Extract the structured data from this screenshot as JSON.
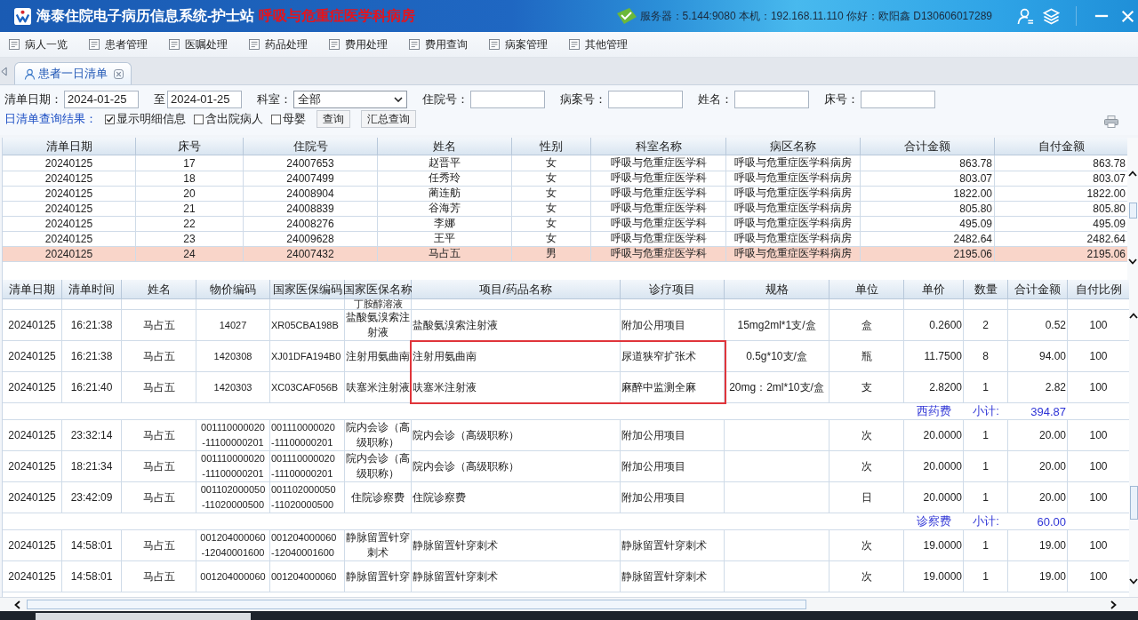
{
  "title_bar": {
    "title": "海泰住院电子病历信息系统-护士站",
    "ward": "呼吸与危重症医学科病房",
    "server_info": "服务器：5.144:9080 本机：192.168.11.110 你好：欧阳鑫 D130606017289"
  },
  "menu": [
    {
      "label": "病人一览"
    },
    {
      "label": "患者管理"
    },
    {
      "label": "医嘱处理"
    },
    {
      "label": "药品处理"
    },
    {
      "label": "费用处理"
    },
    {
      "label": "费用查询"
    },
    {
      "label": "病案管理"
    },
    {
      "label": "其他管理"
    }
  ],
  "tabs": [
    {
      "label": "患者一日清单",
      "selected": true
    }
  ],
  "filters": [
    {
      "label": "清单日期：",
      "kind": "date",
      "value": "2024-01-25"
    },
    {
      "label": "至",
      "kind": "date",
      "value": "2024-01-25"
    },
    {
      "label": "科室：",
      "kind": "select",
      "value": "全部"
    },
    {
      "label": "住院号：",
      "kind": "text"
    },
    {
      "label": "病案号：",
      "kind": "text"
    },
    {
      "label": "姓名：",
      "kind": "text"
    },
    {
      "label": "床号：",
      "kind": "text"
    }
  ],
  "result_bar": {
    "label": "日清单查询结果：",
    "options": [
      {
        "label": "显示明细信息",
        "checked": true
      },
      {
        "label": "含出院病人",
        "checked": false
      },
      {
        "label": "母婴",
        "checked": false
      }
    ],
    "buttons": [
      {
        "label": "查询"
      },
      {
        "label": "汇总查询"
      }
    ]
  },
  "summary_table": {
    "columns": [
      {
        "label": "清单日期"
      },
      {
        "label": "床号"
      },
      {
        "label": "住院号"
      },
      {
        "label": "姓名"
      },
      {
        "label": "性别"
      },
      {
        "label": "科室名称"
      },
      {
        "label": "病区名称"
      },
      {
        "label": "合计金额"
      },
      {
        "label": "自付金额"
      }
    ],
    "rows": [
      {
        "cells": [
          "20240125",
          "17",
          "24007653",
          "赵晋平",
          "女",
          "呼吸与危重症医学科",
          "呼吸与危重症医学科病房",
          "863.78",
          "863.78"
        ],
        "selected": false
      },
      {
        "cells": [
          "20240125",
          "18",
          "24007499",
          "任秀玲",
          "女",
          "呼吸与危重症医学科",
          "呼吸与危重症医学科病房",
          "803.07",
          "803.07"
        ],
        "selected": false
      },
      {
        "cells": [
          "20240125",
          "20",
          "24008904",
          "蔺连舫",
          "女",
          "呼吸与危重症医学科",
          "呼吸与危重症医学科病房",
          "1822.00",
          "1822.00"
        ],
        "selected": false
      },
      {
        "cells": [
          "20240125",
          "21",
          "24008839",
          "谷海芳",
          "女",
          "呼吸与危重症医学科",
          "呼吸与危重症医学科病房",
          "805.80",
          "805.80"
        ],
        "selected": false
      },
      {
        "cells": [
          "20240125",
          "22",
          "24008276",
          "李娜",
          "女",
          "呼吸与危重症医学科",
          "呼吸与危重症医学科病房",
          "495.09",
          "495.09"
        ],
        "selected": false
      },
      {
        "cells": [
          "20240125",
          "23",
          "24009628",
          "王平",
          "女",
          "呼吸与危重症医学科",
          "呼吸与危重症医学科病房",
          "2482.64",
          "2482.64"
        ],
        "selected": false
      },
      {
        "cells": [
          "20240125",
          "24",
          "24007432",
          "马占五",
          "男",
          "呼吸与危重症医学科",
          "呼吸与危重症医学科病房",
          "2195.06",
          "2195.06"
        ],
        "selected": true
      }
    ]
  },
  "detail_table": {
    "columns": [
      {
        "label": "清单日期",
        "highlighted": false
      },
      {
        "label": "清单时间",
        "highlighted": false
      },
      {
        "label": "姓名",
        "highlighted": false
      },
      {
        "label": "物价编码",
        "highlighted": false
      },
      {
        "label": "国家医保编码",
        "highlighted": false
      },
      {
        "label": "国家医保名称",
        "highlighted": false
      },
      {
        "label": "项目/药品名称",
        "highlighted": true
      },
      {
        "label": "诊疗项目",
        "highlighted": true
      },
      {
        "label": "规格",
        "highlighted": false
      },
      {
        "label": "单位",
        "highlighted": false
      },
      {
        "label": "单价",
        "highlighted": false
      },
      {
        "label": "数量",
        "highlighted": false
      },
      {
        "label": "合计金额",
        "highlighted": false
      },
      {
        "label": "自付比例",
        "highlighted": false
      }
    ],
    "rows": [
      {
        "kind": "tail",
        "insurance_name": "丁胺醇溶液"
      },
      {
        "kind": "item",
        "date": "20240125",
        "time": "16:21:38",
        "name": "马占五",
        "price_code": "14027",
        "insurance_code": "XR05CBA198B",
        "insurance_name": "盐酸氨溴索注射液",
        "item_name": "盐酸氨溴索注射液",
        "treatment_item": "附加公用项目",
        "spec": "15mg2ml*1支/盒",
        "unit": "盒",
        "unit_price": "0.2600",
        "quantity": "2",
        "total": "0.52",
        "self_pay_ratio": "100",
        "highlighted": false
      },
      {
        "kind": "item",
        "date": "20240125",
        "time": "16:21:38",
        "name": "马占五",
        "price_code": "1420308",
        "insurance_code": "XJ01DFA194B0",
        "insurance_name": "注射用氨曲南",
        "item_name": "注射用氨曲南",
        "treatment_item": "尿道狭窄扩张术",
        "spec": "0.5g*10支/盒",
        "unit": "瓶",
        "unit_price": "11.7500",
        "quantity": "8",
        "total": "94.00",
        "self_pay_ratio": "100",
        "highlighted": true
      },
      {
        "kind": "item",
        "date": "20240125",
        "time": "16:21:40",
        "name": "马占五",
        "price_code": "1420303",
        "insurance_code": "XC03CAF056B",
        "insurance_name": "呋塞米注射液",
        "item_name": "呋塞米注射液",
        "treatment_item": "麻醉中监测全麻",
        "spec": "20mg：2ml*10支/盒",
        "unit": "支",
        "unit_price": "2.8200",
        "quantity": "1",
        "total": "2.82",
        "self_pay_ratio": "100",
        "highlighted": true
      },
      {
        "kind": "subtotal",
        "category": "西药费",
        "label": "小计:",
        "amount": "394.87"
      },
      {
        "kind": "item",
        "date": "20240125",
        "time": "23:32:14",
        "name": "马占五",
        "price_code": "001110000020\n-11100000201",
        "insurance_code": "001110000020\n-11100000201",
        "insurance_name": "院内会诊（高级职称）",
        "item_name": "院内会诊（高级职称）",
        "treatment_item": "附加公用项目",
        "unit": "次",
        "unit_price": "20.0000",
        "quantity": "1",
        "total": "20.00",
        "self_pay_ratio": "100",
        "highlighted": false
      },
      {
        "kind": "item",
        "date": "20240125",
        "time": "18:21:34",
        "name": "马占五",
        "price_code": "001110000020\n-11100000201",
        "insurance_code": "001110000020\n-11100000201",
        "insurance_name": "院内会诊（高级职称）",
        "item_name": "院内会诊（高级职称）",
        "treatment_item": "附加公用项目",
        "unit": "次",
        "unit_price": "20.0000",
        "quantity": "1",
        "total": "20.00",
        "self_pay_ratio": "100",
        "highlighted": false
      },
      {
        "kind": "item",
        "date": "20240125",
        "time": "23:42:09",
        "name": "马占五",
        "price_code": "001102000050\n-11020000500",
        "insurance_code": "001102000050\n-11020000500",
        "insurance_name": "住院诊察费",
        "item_name": "住院诊察费",
        "treatment_item": "附加公用项目",
        "unit": "日",
        "unit_price": "20.0000",
        "quantity": "1",
        "total": "20.00",
        "self_pay_ratio": "100",
        "highlighted": false
      },
      {
        "kind": "subtotal",
        "category": "诊察费",
        "label": "小计:",
        "amount": "60.00"
      },
      {
        "kind": "item",
        "date": "20240125",
        "time": "14:58:01",
        "name": "马占五",
        "price_code": "001204000060\n-12040001600",
        "insurance_code": "001204000060\n-12040001600",
        "insurance_name": "静脉留置针穿刺术",
        "item_name": "静脉留置针穿刺术",
        "treatment_item": "静脉留置针穿刺术",
        "unit": "次",
        "unit_price": "19.0000",
        "quantity": "1",
        "total": "19.00",
        "self_pay_ratio": "100",
        "highlighted": false
      },
      {
        "kind": "item",
        "date": "20240125",
        "time": "14:58:01",
        "name": "马占五",
        "price_code": "001204000060",
        "insurance_code": "001204000060",
        "insurance_name": "静脉留置针穿",
        "item_name": "静脉留置针穿刺术",
        "treatment_item": "静脉留置针穿刺术",
        "unit": "次",
        "unit_price": "19.0000",
        "quantity": "1",
        "total": "19.00",
        "self_pay_ratio": "100",
        "highlighted": false
      }
    ]
  }
}
